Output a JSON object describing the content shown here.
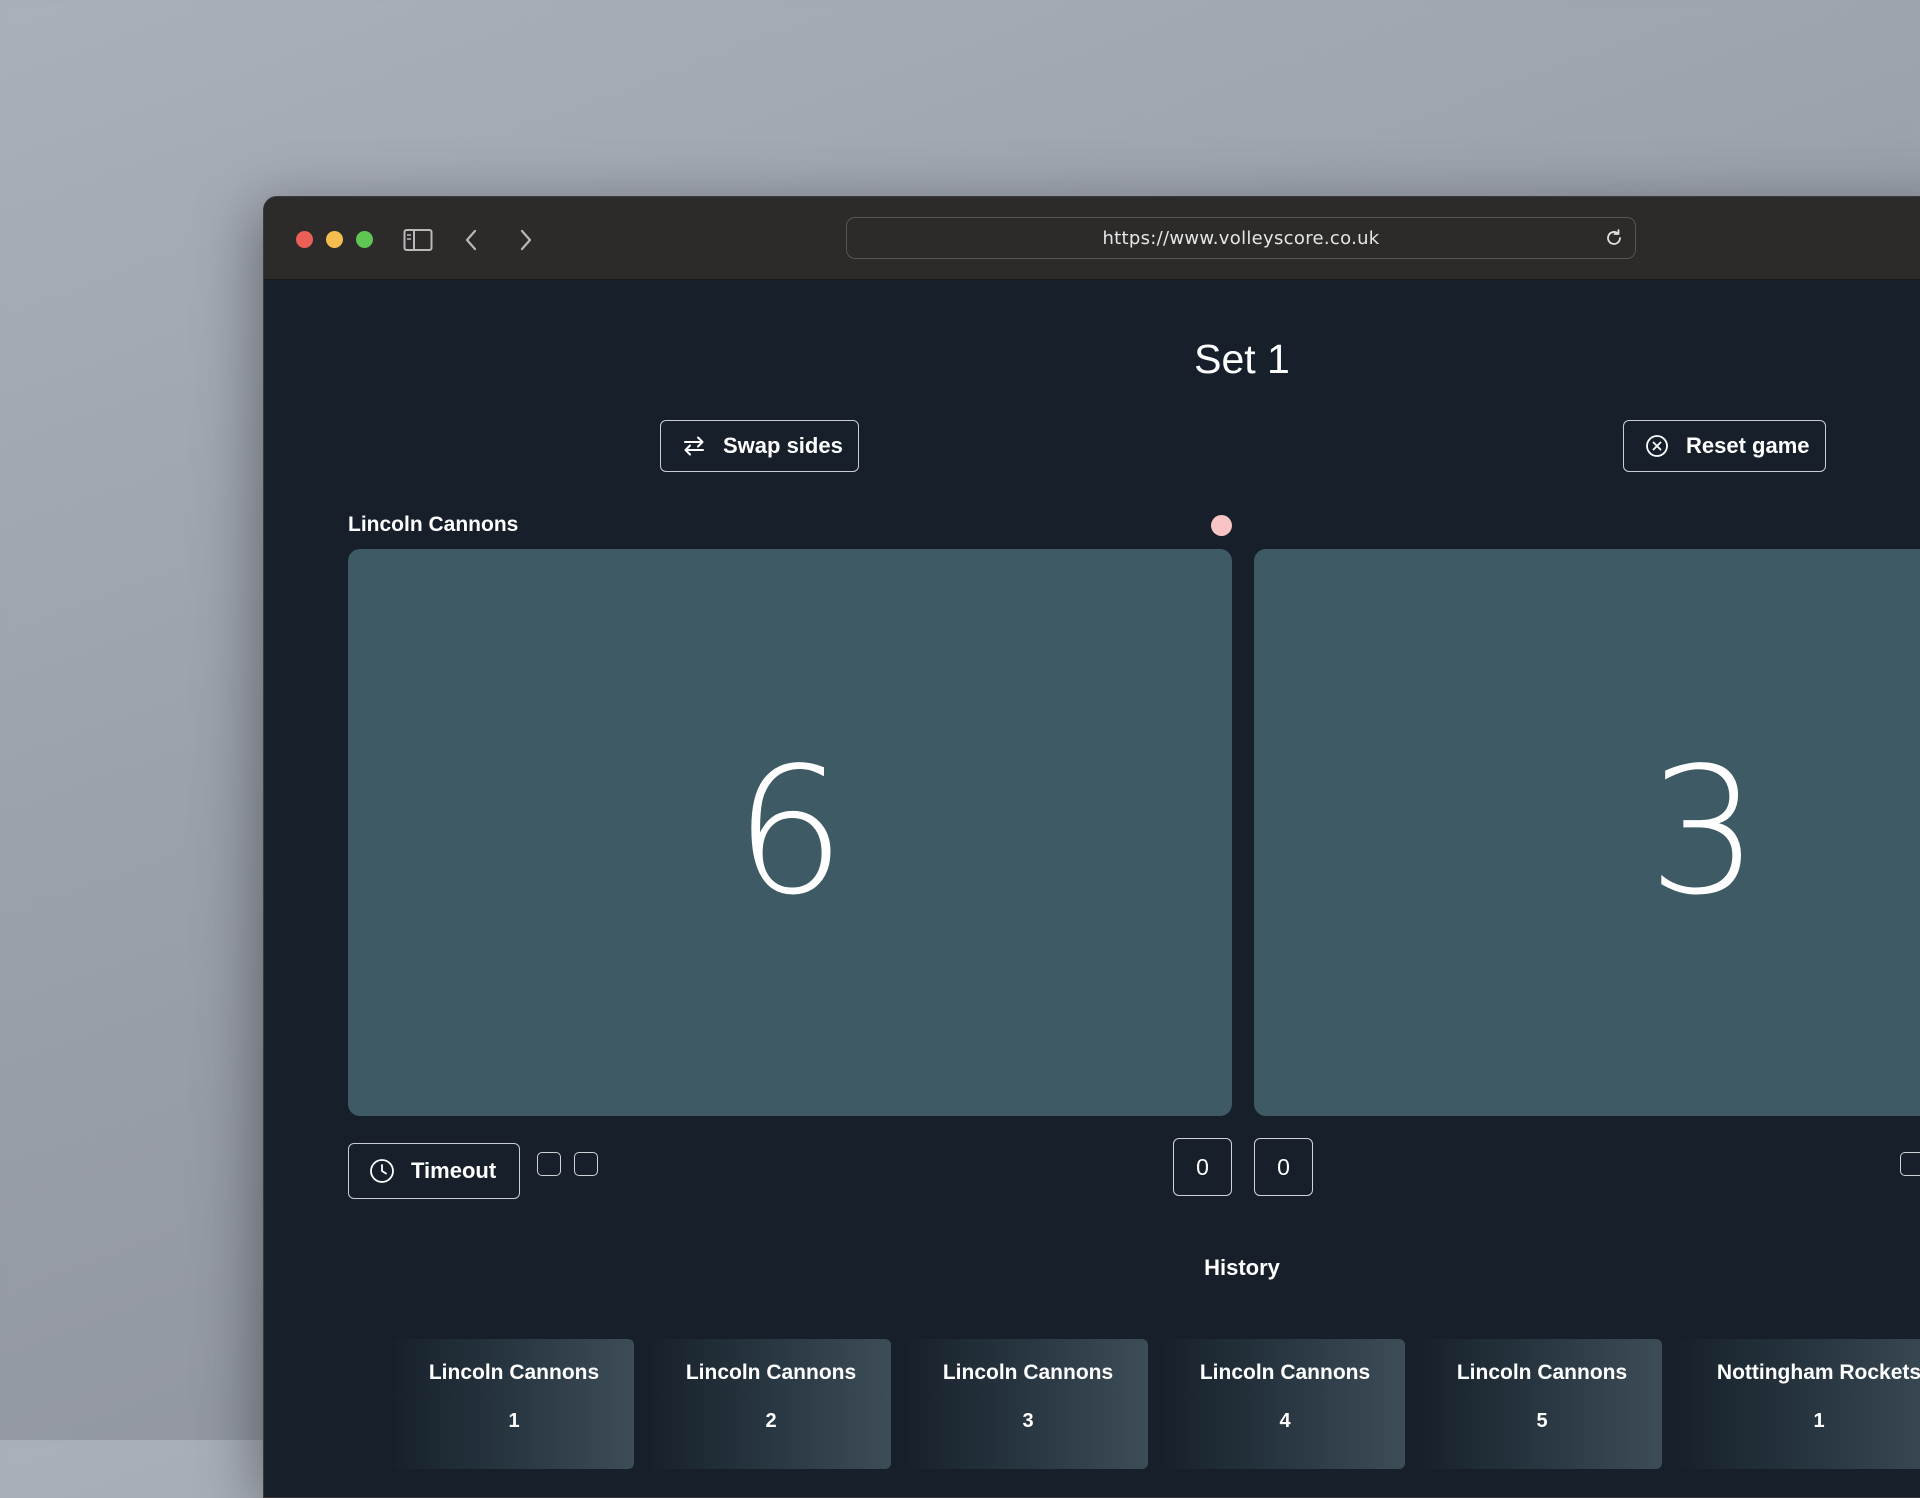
{
  "browser": {
    "url": "https://www.volleyscore.co.uk",
    "icons": [
      "sidebar-icon",
      "back-icon",
      "forward-icon",
      "reload-icon"
    ]
  },
  "game": {
    "set_title": "Set 1",
    "swap_label": "Swap sides",
    "reset_label": "Reset game",
    "timeout_label": "Timeout",
    "left_team": {
      "name": "Lincoln Cannons",
      "score": "6",
      "sets_won": "0",
      "serving": true
    },
    "right_team": {
      "score": "3",
      "sets_won": "0"
    }
  },
  "history": {
    "title": "History",
    "items": [
      {
        "team": "Lincoln Cannons",
        "point": "1"
      },
      {
        "team": "Lincoln Cannons",
        "point": "2"
      },
      {
        "team": "Lincoln Cannons",
        "point": "3"
      },
      {
        "team": "Lincoln Cannons",
        "point": "4"
      },
      {
        "team": "Lincoln Cannons",
        "point": "5"
      },
      {
        "team": "Nottingham Rockets",
        "point": "1"
      }
    ]
  },
  "colors": {
    "background": "#161f2a",
    "score_card": "#3e5b65",
    "serve_indicator": "#f8c4c4"
  }
}
